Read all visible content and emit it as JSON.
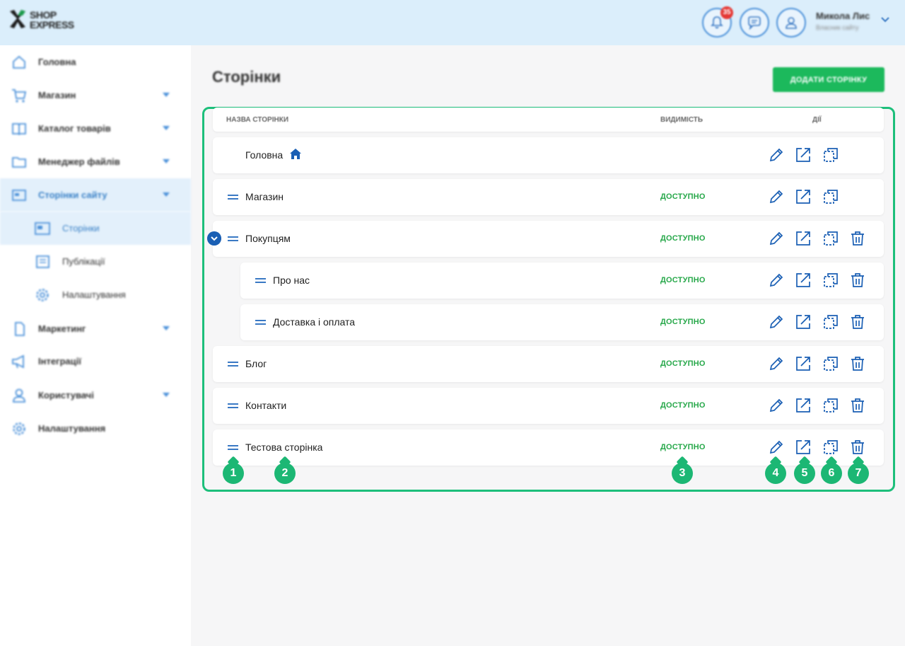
{
  "header": {
    "logo_line1": "SHOP",
    "logo_line2": "EXPRESS",
    "notifications_count": "35",
    "user_name": "Микола Лис",
    "user_role": "Власник сайту"
  },
  "sidebar": {
    "items": [
      {
        "label": "Головна",
        "icon": "home-icon"
      },
      {
        "label": "Магазин",
        "icon": "cart-icon"
      },
      {
        "label": "Каталог товарів",
        "icon": "book-icon"
      },
      {
        "label": "Менеджер файлів",
        "icon": "folder-icon"
      },
      {
        "label": "Сторінки сайту",
        "icon": "pages-icon"
      },
      {
        "label": "Сторінки",
        "icon": "page-icon"
      },
      {
        "label": "Публікації",
        "icon": "news-icon"
      },
      {
        "label": "Налаштування",
        "icon": "gear-icon"
      },
      {
        "label": "Маркетинг",
        "icon": "tag-icon"
      },
      {
        "label": "Інтеграції",
        "icon": "megaphone-icon"
      },
      {
        "label": "Користувачі",
        "icon": "user-icon"
      },
      {
        "label": "Налаштування",
        "icon": "gear-icon"
      }
    ]
  },
  "main": {
    "title": "Сторінки",
    "add_button": "ДОДАТИ СТОРІНКУ",
    "columns": {
      "name": "НАЗВА СТОРІНКИ",
      "visibility": "ВИДИМІСТЬ",
      "actions": "ДІЇ"
    },
    "rows": [
      {
        "name": "Головна",
        "status": ""
      },
      {
        "name": "Магазин",
        "status": "ДОСТУПНО"
      },
      {
        "name": "Покупцям",
        "status": "ДОСТУПНО"
      },
      {
        "name": "Про нас",
        "status": "ДОСТУПНО"
      },
      {
        "name": "Доставка і оплата",
        "status": "ДОСТУПНО"
      },
      {
        "name": "Блог",
        "status": "ДОСТУПНО"
      },
      {
        "name": "Контакти",
        "status": "ДОСТУПНО"
      },
      {
        "name": "Тестова сторінка",
        "status": "ДОСТУПНО"
      }
    ],
    "markers": [
      "1",
      "2",
      "3",
      "4",
      "5",
      "6",
      "7"
    ]
  },
  "colors": {
    "accent_blue": "#3a79c4",
    "status_green": "#27a84a",
    "button_green": "#1cb95c",
    "frame_green": "#1dbf7b"
  }
}
